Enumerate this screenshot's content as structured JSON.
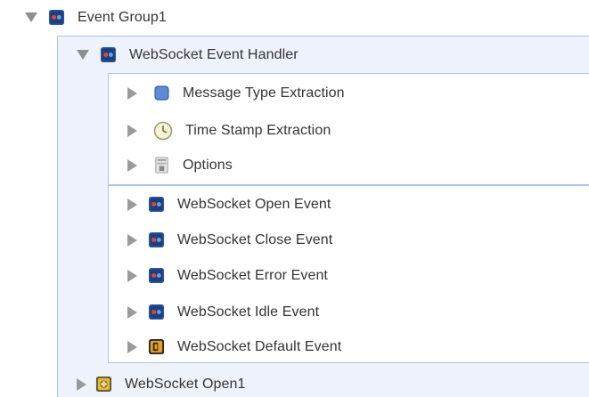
{
  "tree": {
    "group": {
      "label": "Event Group1",
      "icon": "event-group-icon",
      "expanded": true
    },
    "handler": {
      "label": "WebSocket Event Handler",
      "icon": "websocket-handler-icon",
      "expanded": true
    },
    "extractions": [
      {
        "label": "Message Type Extraction",
        "icon": "message-type-icon"
      },
      {
        "label": "Time Stamp Extraction",
        "icon": "clock-icon"
      },
      {
        "label": "Options",
        "icon": "options-icon"
      }
    ],
    "events": [
      {
        "label": "WebSocket Open Event",
        "icon": "websocket-event-icon"
      },
      {
        "label": "WebSocket Close Event",
        "icon": "websocket-event-icon"
      },
      {
        "label": "WebSocket Error Event",
        "icon": "websocket-event-icon"
      },
      {
        "label": "WebSocket Idle Event",
        "icon": "websocket-event-icon"
      },
      {
        "label": "WebSocket Default Event",
        "icon": "default-event-icon"
      }
    ],
    "sibling": {
      "label": "WebSocket Open1",
      "icon": "websocket-open-icon",
      "expanded": false
    }
  },
  "colors": {
    "panel_border": "#a9c6e8",
    "panel_fill": "#eef3fb",
    "icon_blue": "#2c5aa8",
    "icon_orange": "#e8a020"
  }
}
